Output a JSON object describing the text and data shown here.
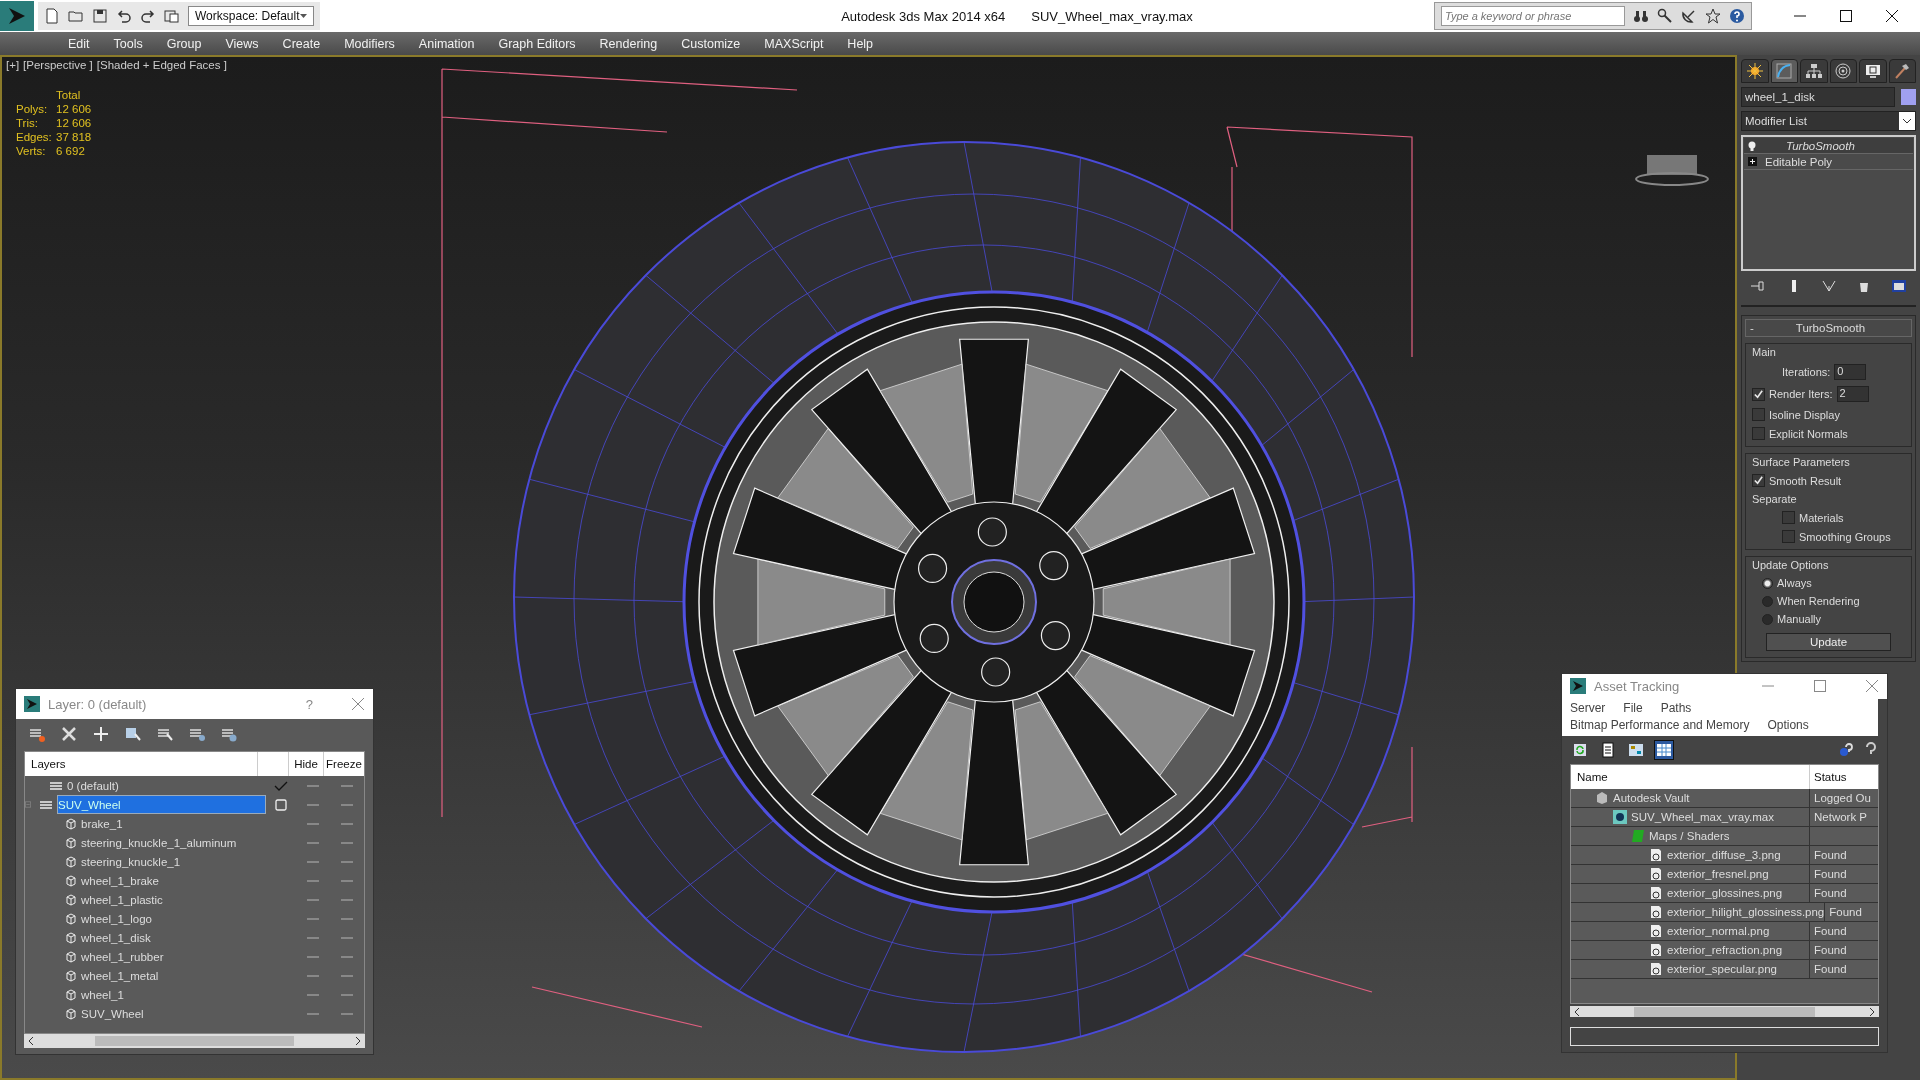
{
  "title_bar": {
    "workspace": "Workspace: Default",
    "app_title": "Autodesk 3ds Max  2014 x64",
    "file_name": "SUV_Wheel_max_vray.max",
    "search": {
      "placeholder": "Type a keyword or phrase"
    }
  },
  "menu_bar": [
    "Edit",
    "Tools",
    "Group",
    "Views",
    "Create",
    "Modifiers",
    "Animation",
    "Graph Editors",
    "Rendering",
    "Customize",
    "MAXScript",
    "Help"
  ],
  "viewport": {
    "labels": [
      "[+]",
      "[Perspective ]",
      "[Shaded + Edged Faces ]"
    ],
    "stats": {
      "header": "Total",
      "rows": [
        {
          "label": "Polys:",
          "value": "12 606"
        },
        {
          "label": "Tris:",
          "value": "12 606"
        },
        {
          "label": "Edges:",
          "value": "37 818"
        },
        {
          "label": "Verts:",
          "value": "6 692"
        }
      ]
    }
  },
  "command_panel": {
    "tabs": [
      {
        "kind": "create",
        "selected": false
      },
      {
        "kind": "modify",
        "selected": true
      },
      {
        "kind": "hierarchy",
        "selected": false
      },
      {
        "kind": "motion",
        "selected": false
      },
      {
        "kind": "display",
        "selected": false
      },
      {
        "kind": "utilities",
        "selected": false
      }
    ],
    "object_name": "wheel_1_disk",
    "modifier_list": "Modifier List",
    "stack": [
      {
        "label": "TurboSmooth",
        "kind": "modifier",
        "selected": true
      },
      {
        "label": "Editable Poly",
        "kind": "base",
        "selected": false
      }
    ],
    "rollout": {
      "title": "TurboSmooth",
      "collapse": "-",
      "main": {
        "title": "Main",
        "iterations_label": "Iterations:",
        "iterations": "0",
        "render_iters_label": "Render Iters:",
        "render_iters_checked": true,
        "render_iters": "2",
        "options": [
          {
            "label": "Isoline Display",
            "checked": false
          },
          {
            "label": "Explicit Normals",
            "checked": false
          }
        ]
      },
      "surface": {
        "title": "Surface Parameters",
        "smooth_result": {
          "label": "Smooth Result",
          "checked": true
        },
        "separate_label": "Separate",
        "separate": [
          {
            "label": "Materials",
            "checked": false
          },
          {
            "label": "Smoothing Groups",
            "checked": false
          }
        ]
      },
      "update": {
        "title": "Update Options",
        "options": [
          {
            "label": "Always",
            "selected": true
          },
          {
            "label": "When Rendering",
            "selected": false
          },
          {
            "label": "Manually",
            "selected": false
          }
        ],
        "button": "Update"
      }
    }
  },
  "layer_window": {
    "title": "Layer: 0 (default)",
    "help": "?",
    "columns": [
      "Layers",
      "Hide",
      "Freeze"
    ],
    "rows": [
      {
        "name": "0 (default)",
        "kind": "layer",
        "current": true,
        "selected": false
      },
      {
        "name": "SUV_Wheel",
        "kind": "layer",
        "current": false,
        "selected": true,
        "expanded": true,
        "children": [
          {
            "name": "brake_1",
            "kind": "object"
          },
          {
            "name": "steering_knuckle_1_aluminum",
            "kind": "object"
          },
          {
            "name": "steering_knuckle_1",
            "kind": "object"
          },
          {
            "name": "wheel_1_brake",
            "kind": "object"
          },
          {
            "name": "wheel_1_plastic",
            "kind": "object"
          },
          {
            "name": "wheel_1_logo",
            "kind": "object"
          },
          {
            "name": "wheel_1_disk",
            "kind": "object"
          },
          {
            "name": "wheel_1_rubber",
            "kind": "object"
          },
          {
            "name": "wheel_1_metal",
            "kind": "object"
          },
          {
            "name": "wheel_1",
            "kind": "object"
          },
          {
            "name": "SUV_Wheel",
            "kind": "object"
          }
        ]
      }
    ]
  },
  "asset_tracking": {
    "title": "Asset Tracking",
    "menu": [
      "Server",
      "File",
      "Paths",
      "Bitmap Performance and Memory",
      "Options"
    ],
    "toolbar": [
      {
        "kind": "refresh",
        "selected": false
      },
      {
        "kind": "list",
        "selected": false
      },
      {
        "kind": "thumbnails",
        "selected": false
      },
      {
        "kind": "table",
        "selected": true
      }
    ],
    "columns": [
      "Name",
      "Status"
    ],
    "rows": [
      {
        "name": "Autodesk Vault",
        "kind": "vault",
        "status": "Logged Ou",
        "children": [
          {
            "name": "SUV_Wheel_max_vray.max",
            "kind": "scene",
            "status": "Network P",
            "children": [
              {
                "name": "Maps / Shaders",
                "kind": "folder",
                "children": [
                  {
                    "name": "exterior_diffuse_3.png",
                    "kind": "bitmap",
                    "status": "Found"
                  },
                  {
                    "name": "exterior_fresnel.png",
                    "kind": "bitmap",
                    "status": "Found"
                  },
                  {
                    "name": "exterior_glossines.png",
                    "kind": "bitmap",
                    "status": "Found"
                  },
                  {
                    "name": "exterior_hilight_glossiness.png",
                    "kind": "bitmap",
                    "status": "Found"
                  },
                  {
                    "name": "exterior_normal.png",
                    "kind": "bitmap",
                    "status": "Found"
                  },
                  {
                    "name": "exterior_refraction.png",
                    "kind": "bitmap",
                    "status": "Found"
                  },
                  {
                    "name": "exterior_specular.png",
                    "kind": "bitmap",
                    "status": "Found"
                  }
                ]
              }
            ]
          }
        ]
      }
    ]
  }
}
